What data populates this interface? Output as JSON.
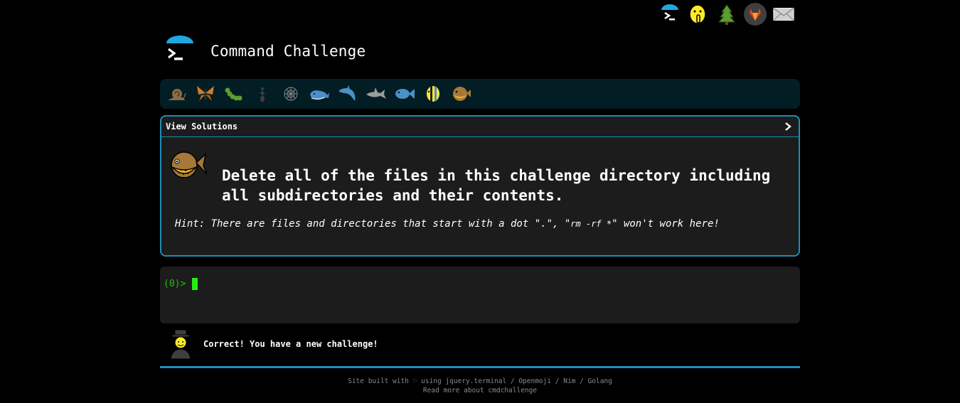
{
  "top_icons": [
    "terminal-icon",
    "shushing-face-icon",
    "tree-icon",
    "gitlab-icon",
    "mail-icon"
  ],
  "header": {
    "title": "Command Challenge"
  },
  "levels": [
    "snail-icon",
    "butterfly-icon",
    "caterpillar-icon",
    "ant-icon",
    "spider-web-icon",
    "whale-icon",
    "dolphin-icon",
    "shark-icon",
    "fish-icon",
    "tropical-fish-icon",
    "blowfish-icon"
  ],
  "card": {
    "view_solutions": "View Solutions",
    "challenge_text": "Delete all of the files in this challenge directory including all subdirectories and their contents.",
    "hint_prefix": "Hint: There are files and directories that start with a dot \".\", \"",
    "hint_code": "rm -rf *",
    "hint_suffix": "\" won't work here!"
  },
  "terminal": {
    "prompt": "(0)>"
  },
  "feedback": {
    "message": "Correct! You have a new challenge!",
    "progress": 1.0
  },
  "footer": {
    "line1": "Site built with ♡ using jquery.terminal / Openmoji / Nim / Golang",
    "line2": "Read more about cmdchallenge"
  },
  "colors": {
    "accent": "#1a8fb4",
    "prompt": "#25c00c",
    "cursor": "#22ee10",
    "card_bg": "#1c1c1c",
    "level_bar_bg": "#021d24"
  }
}
